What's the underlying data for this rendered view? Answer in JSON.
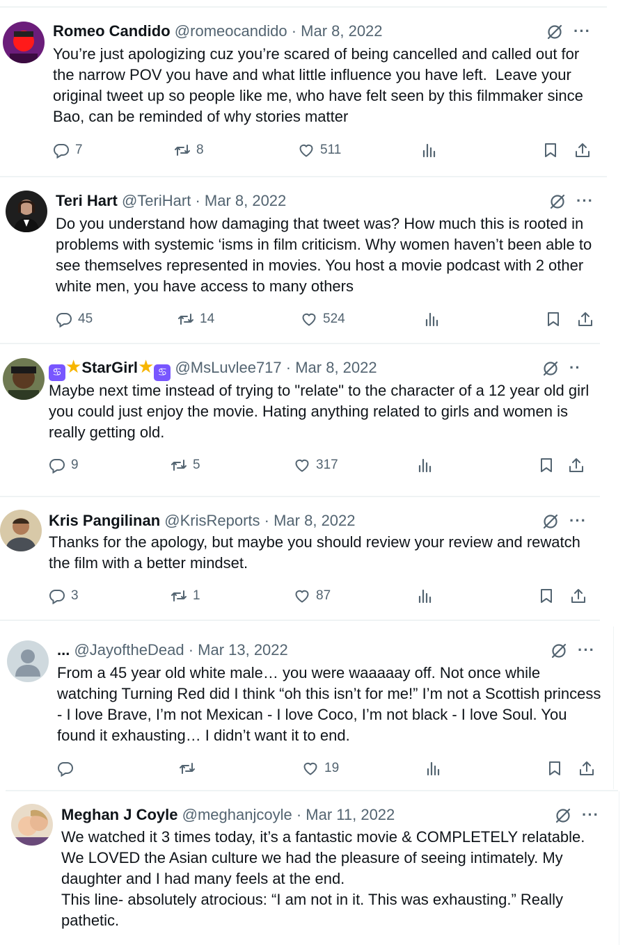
{
  "tweets": [
    {
      "name": "Romeo Candido",
      "handle": "@romeocandido",
      "date": "· Mar 8, 2022",
      "text": "You’re just apologizing cuz you’re scared of being cancelled and called out for the narrow POV you have and what little influence you have left.  Leave your original tweet up so people like me, who have felt seen by this filmmaker since Bao, can be reminded of why stories matter",
      "replies": "7",
      "retweets": "8",
      "likes": "511"
    },
    {
      "name": "Teri Hart",
      "handle": "@TeriHart",
      "date": "· Mar 8, 2022",
      "text": "Do you understand how damaging that tweet was? How much this is rooted in problems with systemic ‘isms in film criticism. Why women haven’t been able to see themselves represented in movies. You host a movie podcast with 2 other white men, you have access to many others",
      "replies": "45",
      "retweets": "14",
      "likes": "524"
    },
    {
      "name": "StarGirl",
      "handle": "@MsLuvlee717",
      "date": "· Mar 8, 2022",
      "text": "Maybe next time instead of trying to \"relate\" to the character of a 12 year old girl you could just enjoy the movie. Hating anything related to girls and women is really getting old.",
      "replies": "9",
      "retweets": "5",
      "likes": "317"
    },
    {
      "name": "Kris Pangilinan",
      "handle": "@KrisReports",
      "date": "· Mar 8, 2022",
      "text": "Thanks for the apology, but maybe you should review your review and rewatch the film with a better mindset.",
      "replies": "3",
      "retweets": "1",
      "likes": "87"
    },
    {
      "name": "...",
      "handle": "@JayoftheDead",
      "date": "· Mar 13, 2022",
      "text": "From a 45 year old white male… you were waaaaay off. Not once while watching Turning Red did I think “oh this isn’t for me!” I’m not a Scottish princess - I love Brave, I’m not Mexican - I love Coco, I’m not black - I love Soul. You found it exhausting… I didn’t want it to end.",
      "replies": "",
      "retweets": "",
      "likes": "19"
    },
    {
      "name": "Meghan J Coyle",
      "handle": "@meghanjcoyle",
      "date": "· Mar 11, 2022",
      "text": "We watched it 3 times today, it’s a fantastic movie & COMPLETELY relatable. We LOVED the Asian culture we had the pleasure of seeing intimately. My daughter and I had many feels at the end.\nThis line- absolutely atrocious: “I am not in it. This was exhausting.” Really pathetic."
    }
  ],
  "icons": {
    "reply": "reply-icon",
    "retweet": "retweet-icon",
    "like": "heart-icon",
    "views": "analytics-icon",
    "bookmark": "bookmark-icon",
    "share": "share-icon",
    "grok": "grok-icon",
    "more": "more-icon"
  },
  "colors": {
    "text": "#0f1419",
    "secondary": "#536471",
    "divider": "#eff3f4",
    "sign": "#7856ff",
    "star": "#f7b500"
  }
}
